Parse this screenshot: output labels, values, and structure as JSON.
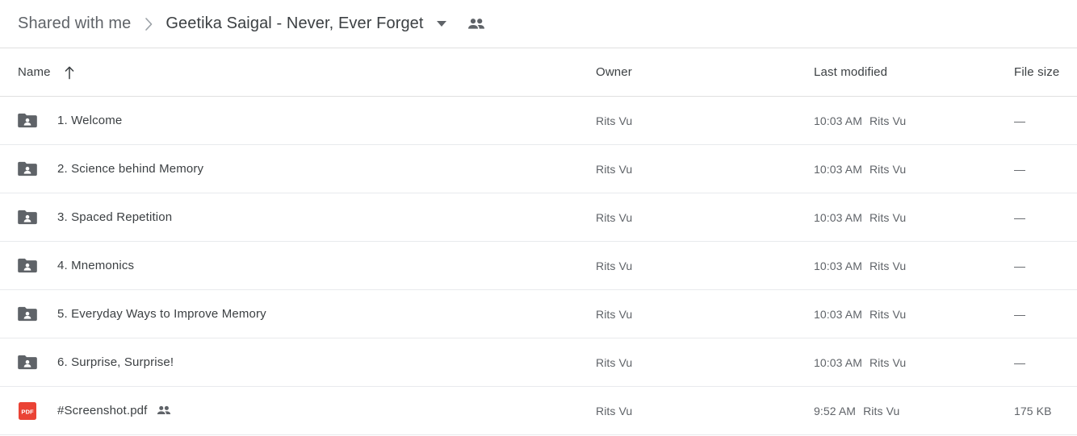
{
  "header": {
    "breadcrumb_root": "Shared with me",
    "breadcrumb_separator_icon": "chevron-right-icon",
    "breadcrumb_current": "Geetika Saigal - Never, Ever Forget",
    "dropdown_icon": "caret-down-icon",
    "shared_icon": "people-shared-icon"
  },
  "table": {
    "columns": {
      "name": "Name",
      "owner": "Owner",
      "last_modified": "Last modified",
      "file_size": "File size"
    },
    "sort_icon": "arrow-up-icon",
    "rows": [
      {
        "icon": "shared-folder-icon",
        "name": "1. Welcome",
        "shared": false,
        "owner": "Rits Vu",
        "modified_time": "10:03 AM",
        "modified_by": "Rits Vu",
        "size": "—"
      },
      {
        "icon": "shared-folder-icon",
        "name": "2. Science behind Memory",
        "shared": false,
        "owner": "Rits Vu",
        "modified_time": "10:03 AM",
        "modified_by": "Rits Vu",
        "size": "—"
      },
      {
        "icon": "shared-folder-icon",
        "name": "3. Spaced Repetition",
        "shared": false,
        "owner": "Rits Vu",
        "modified_time": "10:03 AM",
        "modified_by": "Rits Vu",
        "size": "—"
      },
      {
        "icon": "shared-folder-icon",
        "name": "4. Mnemonics",
        "shared": false,
        "owner": "Rits Vu",
        "modified_time": "10:03 AM",
        "modified_by": "Rits Vu",
        "size": "—"
      },
      {
        "icon": "shared-folder-icon",
        "name": "5. Everyday Ways to Improve Memory",
        "shared": false,
        "owner": "Rits Vu",
        "modified_time": "10:03 AM",
        "modified_by": "Rits Vu",
        "size": "—"
      },
      {
        "icon": "shared-folder-icon",
        "name": "6. Surprise, Surprise!",
        "shared": false,
        "owner": "Rits Vu",
        "modified_time": "10:03 AM",
        "modified_by": "Rits Vu",
        "size": "—"
      },
      {
        "icon": "pdf-file-icon",
        "icon_label": "PDF",
        "name": "#Screenshot.pdf",
        "shared": true,
        "shared_icon": "people-shared-icon",
        "owner": "Rits Vu",
        "modified_time": "9:52 AM",
        "modified_by": "Rits Vu",
        "size": "175 KB"
      }
    ]
  },
  "colors": {
    "folder_icon": "#5f6368",
    "pdf_icon": "#ea4335",
    "text_primary": "#3c4043",
    "text_secondary": "#5f6368",
    "divider": "#e8eaed"
  }
}
